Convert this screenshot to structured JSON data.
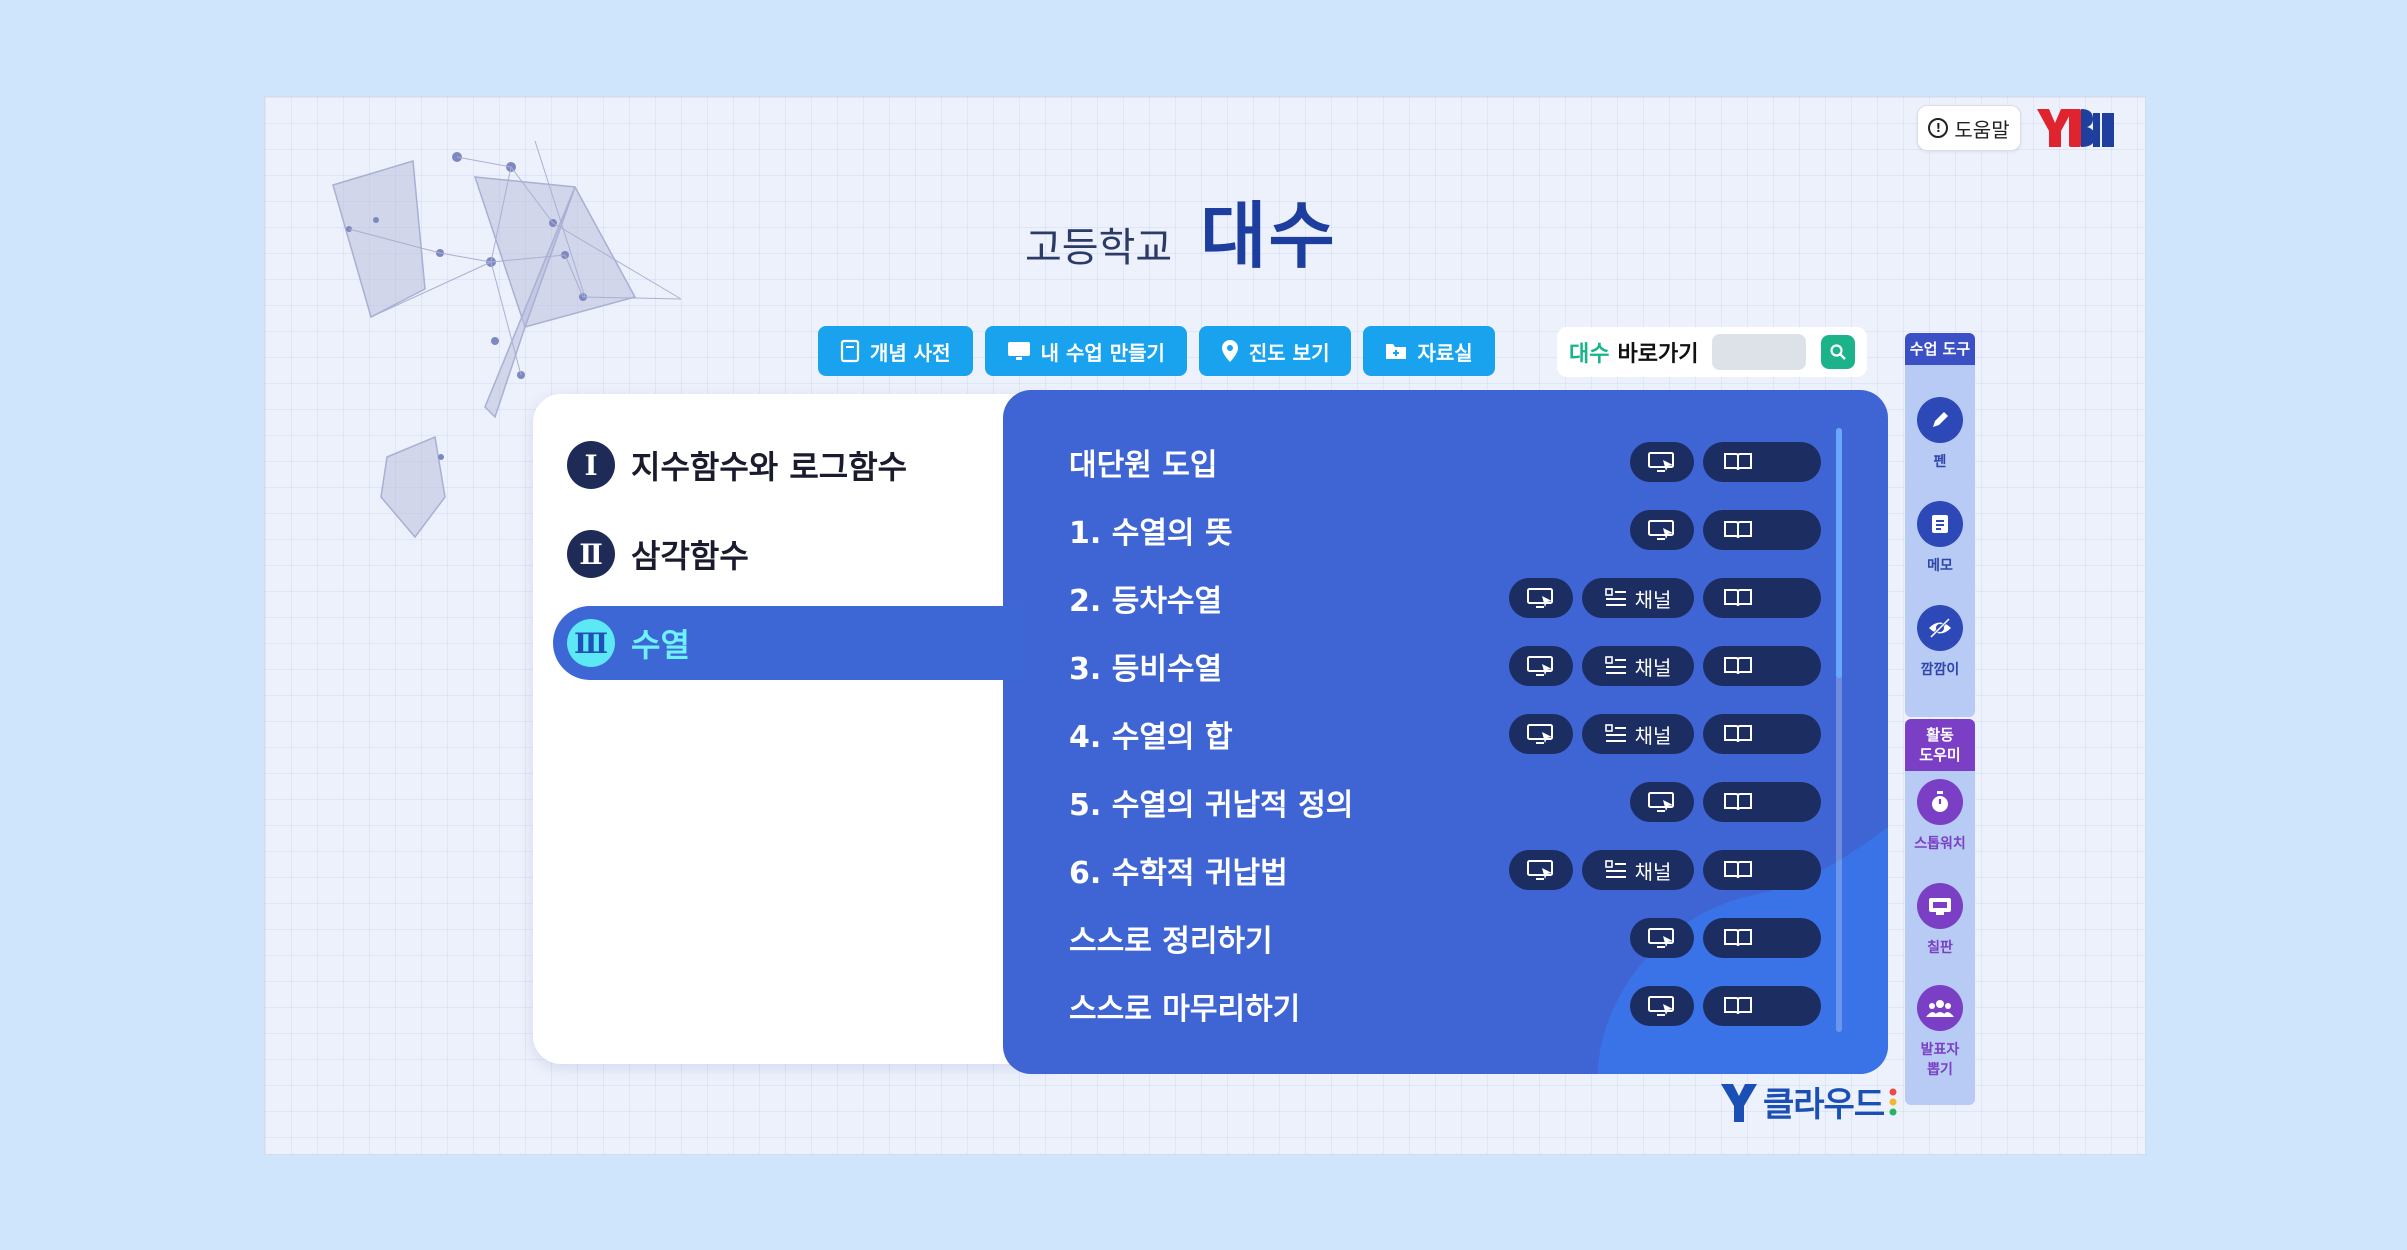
{
  "header": {
    "help_label": "도움말",
    "brand_logo": "YBM",
    "title_small": "고등학교",
    "title_big": "대수"
  },
  "toolbar": {
    "buttons": [
      {
        "label": "개념 사전",
        "icon": "book-icon"
      },
      {
        "label": "내 수업 만들기",
        "icon": "monitor-icon"
      },
      {
        "label": "진도 보기",
        "icon": "location-pin-icon"
      },
      {
        "label": "자료실",
        "icon": "folder-icon"
      }
    ]
  },
  "shortcut": {
    "subject": "대수",
    "label": "바로가기",
    "input_value": ""
  },
  "units": [
    {
      "num": "Ⅰ",
      "label": "지수함수와 로그함수"
    },
    {
      "num": "Ⅱ",
      "label": "삼각함수"
    },
    {
      "num": "Ⅲ",
      "label": "수열"
    }
  ],
  "lessons": [
    {
      "title": "대단원 도입",
      "channel": false
    },
    {
      "title": "1. 수열의 뜻",
      "channel": false
    },
    {
      "title": "2. 등차수열",
      "channel": true
    },
    {
      "title": "3. 등비수열",
      "channel": true
    },
    {
      "title": "4. 수열의 합",
      "channel": true
    },
    {
      "title": "5. 수열의 귀납적 정의",
      "channel": false
    },
    {
      "title": "6. 수학적 귀납법",
      "channel": true
    },
    {
      "title": "스스로 정리하기",
      "channel": false
    },
    {
      "title": "스스로 마무리하기",
      "channel": false
    }
  ],
  "channel_label": "채널",
  "side_tools": {
    "title": "수업 도구",
    "items": [
      "펜",
      "메모",
      "깜깜이"
    ]
  },
  "side_activity": {
    "title_line1": "활동",
    "title_line2": "도우미",
    "items": [
      "스톱워치",
      "칠판"
    ],
    "presenter_line1": "발표자",
    "presenter_line2": "뽑기"
  },
  "footer_logo": "클라우드",
  "colors": {
    "background": "#cfe5fb",
    "accent_blue": "#19a3ee",
    "panel_blue": "#3e65d3",
    "active_cyan": "#6ff2ff",
    "search_green": "#1cb38a"
  }
}
